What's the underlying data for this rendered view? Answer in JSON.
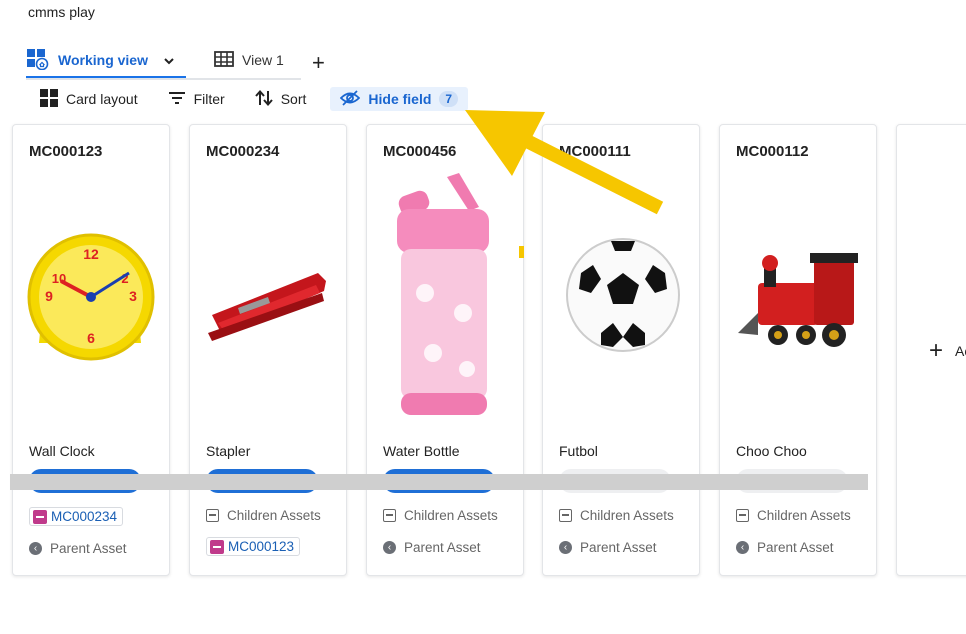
{
  "app": {
    "title": "cmms play"
  },
  "tabs": [
    {
      "label": "Working view",
      "active": true
    },
    {
      "label": "View 1",
      "active": false
    }
  ],
  "toolbar": {
    "card_layout": "Card layout",
    "filter": "Filter",
    "sort": "Sort",
    "hide_field": "Hide field",
    "hide_field_count": "7"
  },
  "cards": [
    {
      "id": "MC000123",
      "name": "Wall Clock",
      "image": "clock-image",
      "children_label": "",
      "child_chip": "MC000234",
      "parent_label": "Parent Asset",
      "parent_chip": ""
    },
    {
      "id": "MC000234",
      "name": "Stapler",
      "image": "stapler-image",
      "children_label": "Children Assets",
      "child_chip": "",
      "parent_label": "",
      "parent_chip": "MC000123"
    },
    {
      "id": "MC000456",
      "name": "Water Bottle",
      "image": "water-bottle-image",
      "children_label": "Children Assets",
      "child_chip": "",
      "parent_label": "Parent Asset",
      "parent_chip": ""
    },
    {
      "id": "MC000111",
      "name": "Futbol",
      "image": "soccer-ball-image",
      "children_label": "Children Assets",
      "child_chip": "",
      "parent_label": "Parent Asset",
      "parent_chip": ""
    },
    {
      "id": "MC000112",
      "name": "Choo Choo",
      "image": "toy-train-image",
      "children_label": "Children Assets",
      "child_chip": "",
      "parent_label": "Parent Asset",
      "parent_chip": ""
    }
  ],
  "add_card": {
    "label": "Ac"
  },
  "colors": {
    "accent": "#1a73e8",
    "annotation_arrow": "#f6c600",
    "chip_icon": "#c03a8b"
  }
}
